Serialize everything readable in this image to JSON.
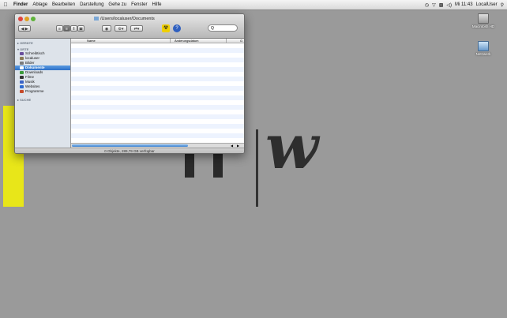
{
  "menubar": {
    "apple_icon": "apple-icon",
    "items": [
      "Finder",
      "Ablage",
      "Bearbeiten",
      "Darstellung",
      "Gehe zu",
      "Fenster",
      "Hilfe"
    ],
    "clock": "Mi 11:43",
    "user": "LocalUser"
  },
  "desktop": {
    "icons": [
      {
        "label": "Macintosh HD"
      },
      {
        "label": "Netzwerk"
      }
    ]
  },
  "window": {
    "title": "/Users/localuser/Documents",
    "columns": {
      "name": "Name",
      "date": "Änderungsdatum",
      "extra": "G"
    },
    "status": "0 Objekte, 289,79 GB verfügbar",
    "search_placeholder": "Q",
    "sidebar": {
      "sections": [
        {
          "title": "GERÄTE",
          "items": []
        },
        {
          "title": "ORTE",
          "items": [
            {
              "label": "Schreibtisch",
              "icon": "desktop-icon",
              "color": "#6a4f9c"
            },
            {
              "label": "localuser",
              "icon": "home-icon",
              "color": "#8a7b55"
            },
            {
              "label": "Bilder",
              "icon": "pictures-icon",
              "color": "#7a7a7a"
            },
            {
              "label": "Dokumente",
              "icon": "documents-icon",
              "color": "#ffffff",
              "selected": true
            },
            {
              "label": "Downloads",
              "icon": "downloads-icon",
              "color": "#3b9a3b"
            },
            {
              "label": "Filme",
              "icon": "movies-icon",
              "color": "#333333"
            },
            {
              "label": "Musik",
              "icon": "music-icon",
              "color": "#3a63c7"
            },
            {
              "label": "Websites",
              "icon": "websites-icon",
              "color": "#2d6ad1"
            },
            {
              "label": "Programme",
              "icon": "applications-icon",
              "color": "#c64a2a"
            }
          ]
        },
        {
          "title": "SUCHE",
          "items": []
        }
      ]
    }
  }
}
